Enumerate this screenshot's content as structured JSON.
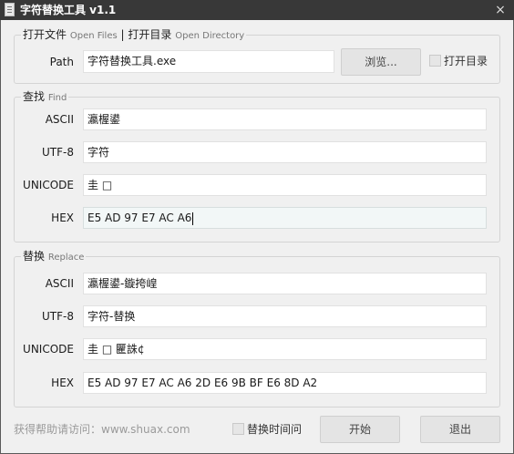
{
  "window": {
    "title": "字符替换工具 v1.1",
    "close_glyph": "×"
  },
  "open_group": {
    "title_cn": "打开文件",
    "title_en": "Open Files",
    "sep": "|",
    "title_cn2": "打开目录",
    "title_en2": "Open Directory",
    "path_label": "Path",
    "path_value": "字符替换工具.exe",
    "browse_label": "浏览...",
    "open_dir_checkbox": "打开目录"
  },
  "find_group": {
    "title_cn": "查找",
    "title_en": "Find",
    "rows": [
      {
        "label": "ASCII",
        "value": "瀛楃鍙"
      },
      {
        "label": "UTF-8",
        "value": "字符"
      },
      {
        "label": "UNICODE",
        "value": "圭 □"
      },
      {
        "label": "HEX",
        "value": "E5 AD 97 E7 AC A6"
      }
    ]
  },
  "replace_group": {
    "title_cn": "替换",
    "title_en": "Replace",
    "rows": [
      {
        "label": "ASCII",
        "value": "瀛楃鍙-鏇挎崲"
      },
      {
        "label": "UTF-8",
        "value": "字符-替换"
      },
      {
        "label": "UNICODE",
        "value": "圭 □  匷誅¢"
      },
      {
        "label": "HEX",
        "value": "E5 AD 97 E7 AC A6 2D E6 9B BF E6 8D A2"
      }
    ]
  },
  "footer": {
    "help_text": "获得帮助请访问：www.shuax.com",
    "time_checkbox": "替换时间问",
    "start_label": "开始",
    "exit_label": "退出"
  }
}
